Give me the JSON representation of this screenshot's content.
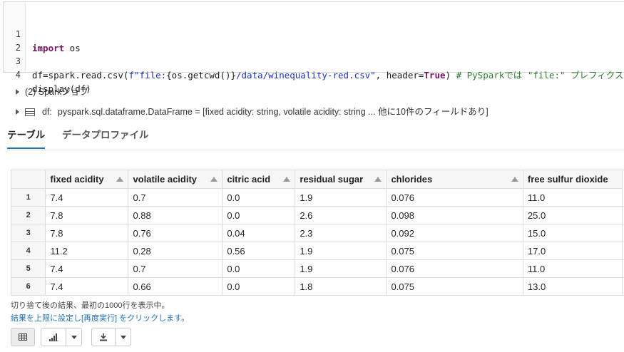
{
  "code": {
    "lines": [
      {
        "num": "1"
      },
      {
        "num": "2"
      },
      {
        "num": "3"
      },
      {
        "num": "4"
      }
    ],
    "line1": {
      "kw": "import",
      "rest": " os"
    },
    "line3": {
      "p1": "df=spark.read.csv(",
      "p2": "f\"file:",
      "p3": "{os.getcwd()}",
      "p4": "/data/winequality-red.csv\"",
      "p5": ", header=",
      "p6": "True",
      "p7": ") ",
      "p8": "# PySparkでは \"file:\" プレフィクス"
    },
    "line4": "display(df)"
  },
  "meta": {
    "jobs": "(2) Sparkジョブ",
    "df_name": "df:",
    "df_schema": "pyspark.sql.dataframe.DataFrame = [fixed acidity: string, volatile acidity: string ... 他に10件のフィールドあり]"
  },
  "tabs": {
    "table": "テーブル",
    "profile": "データプロファイル"
  },
  "table": {
    "columns": [
      "fixed acidity",
      "volatile acidity",
      "citric acid",
      "residual sugar",
      "chlorides",
      "free sulfur dioxide"
    ],
    "rows": [
      {
        "idx": "1",
        "cells": [
          "7.4",
          "0.7",
          "0.0",
          "1.9",
          "0.076",
          "11.0"
        ]
      },
      {
        "idx": "2",
        "cells": [
          "7.8",
          "0.88",
          "0.0",
          "2.6",
          "0.098",
          "25.0"
        ]
      },
      {
        "idx": "3",
        "cells": [
          "7.8",
          "0.76",
          "0.04",
          "2.3",
          "0.092",
          "15.0"
        ]
      },
      {
        "idx": "4",
        "cells": [
          "11.2",
          "0.28",
          "0.56",
          "1.9",
          "0.075",
          "17.0"
        ]
      },
      {
        "idx": "5",
        "cells": [
          "7.4",
          "0.7",
          "0.0",
          "1.9",
          "0.076",
          "11.0"
        ]
      },
      {
        "idx": "6",
        "cells": [
          "7.4",
          "0.66",
          "0.0",
          "1.8",
          "0.075",
          "13.0"
        ]
      }
    ]
  },
  "notes": {
    "truncated": "切り捨て後の結果、最初の1000行を表示中。",
    "rerun": "結果を上限に設定し[再度実行] をクリックします。"
  },
  "icons": {
    "table_view": "table-grid-icon",
    "chart": "bar-chart-icon",
    "download": "download-icon",
    "dropdown": "chevron-down-icon"
  },
  "colors": {
    "accent": "#2272b4",
    "keyword": "#7a1060",
    "string": "#1f31b8",
    "comment": "#2e7d32"
  }
}
